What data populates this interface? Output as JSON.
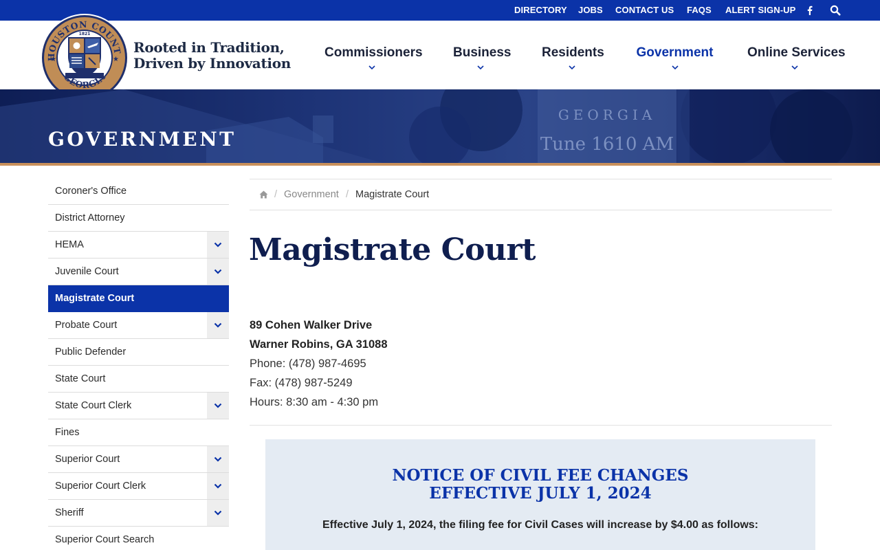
{
  "topbar": {
    "links": [
      "DIRECTORY",
      "JOBS",
      "CONTACT US",
      "FAQS",
      "ALERT SIGN-UP"
    ],
    "icons": [
      "facebook-icon",
      "search-icon"
    ]
  },
  "header": {
    "seal": {
      "ring_top": "HOUSTON COUNTY",
      "ring_bottom": "GEORGIA",
      "year": "1821"
    },
    "tagline_line1": "Rooted in Tradition,",
    "tagline_line2": "Driven by Innovation",
    "nav": [
      {
        "label": "Commissioners",
        "active": false
      },
      {
        "label": "Business",
        "active": false
      },
      {
        "label": "Residents",
        "active": false
      },
      {
        "label": "Government",
        "active": true
      },
      {
        "label": "Online Services",
        "active": false
      }
    ]
  },
  "hero": {
    "title": "GOVERNMENT",
    "sign_line1": "GEORGIA",
    "sign_line2": "Tune 1610 AM"
  },
  "sidebar": {
    "items": [
      {
        "label": "Coroner's Office",
        "expandable": false,
        "active": false
      },
      {
        "label": "District Attorney",
        "expandable": false,
        "active": false
      },
      {
        "label": "HEMA",
        "expandable": true,
        "active": false
      },
      {
        "label": "Juvenile Court",
        "expandable": true,
        "active": false
      },
      {
        "label": "Magistrate Court",
        "expandable": false,
        "active": true
      },
      {
        "label": "Probate Court",
        "expandable": true,
        "active": false
      },
      {
        "label": "Public Defender",
        "expandable": false,
        "active": false
      },
      {
        "label": "State Court",
        "expandable": false,
        "active": false
      },
      {
        "label": "State Court Clerk",
        "expandable": true,
        "active": false
      },
      {
        "label": "Fines",
        "expandable": false,
        "active": false
      },
      {
        "label": "Superior Court",
        "expandable": true,
        "active": false
      },
      {
        "label": "Superior Court Clerk",
        "expandable": true,
        "active": false
      },
      {
        "label": "Sheriff",
        "expandable": true,
        "active": false
      },
      {
        "label": "Superior Court Search",
        "expandable": false,
        "active": false
      }
    ]
  },
  "breadcrumb": {
    "home_icon": "home-icon",
    "parent": "Government",
    "separator": "/",
    "current": "Magistrate Court"
  },
  "page": {
    "title": "Magistrate Court",
    "address_line1": "89 Cohen Walker Drive",
    "address_line2": "Warner Robins, GA 31088",
    "phone": "Phone: (478) 987-4695",
    "fax": "Fax: (478) 987-5249",
    "hours": "Hours: 8:30 am - 4:30 pm"
  },
  "notice": {
    "heading_line1": "NOTICE OF CIVIL FEE CHANGES",
    "heading_line2": "EFFECTIVE JULY 1, 2024",
    "body": "Effective July 1, 2024, the filing fee for Civil Cases will increase by $4.00 as follows:"
  },
  "colors": {
    "brand_blue": "#0b33a8",
    "navy": "#0f1e4f",
    "accent_copper": "#c9905b",
    "notice_bg": "#e4ebf3"
  }
}
